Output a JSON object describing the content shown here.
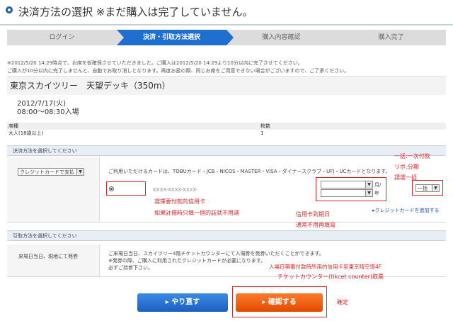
{
  "header": {
    "title": "決済方法の選択 ※まだ購入は完了していません。"
  },
  "steps": [
    {
      "label": "ログイン"
    },
    {
      "label": "決済・引取方法選択"
    },
    {
      "label": "購入内容確認"
    },
    {
      "label": "購入完了"
    }
  ],
  "notice": {
    "line1": "※2012/5/20 14:29時点で、お席を仮確保させていただきました。ご購入は2012/5/20 14:29より10分以内に完了させてください。",
    "line2": "ご購入が10分以内に完了しませんと、自動でお取り消しとなります。再度お扱の際、同じお席をご用意できない場合がございますので、ご了承ください。"
  },
  "event": {
    "name": "東京スカイツリー　天望デッキ（350m）",
    "date": "2012/7/17(火)",
    "time": "08:00〜08:30入場"
  },
  "seat_table": {
    "headers": [
      "席種",
      "枚数"
    ],
    "rows": [
      [
        "大人(18歳以上)",
        "1"
      ]
    ]
  },
  "payment": {
    "section_title": "決済方法を選択してください",
    "method_selected": "クレジットカードで支払",
    "cards_text": "ご利用いただけるカードは、TOBUカード・JCB・NICOS・MASTER・VISA・ダイナースクラブ・UFJ・UCカードとなります。",
    "card_number": "XXXX-XXXX-XXXX-",
    "month_label": "月/",
    "year_label": "年",
    "installment_value": "一括",
    "add_card_link": "▸クレジットカードを追加する"
  },
  "receive": {
    "section_title": "引取方法を選択してください",
    "method": "来場日当日、現地にて発券",
    "desc1": "ご来場日当日、スカイツリー4階チケットカウンターにて入場券を発券いただくことができます。",
    "desc2": "※発券の際、ご購入に利用されたクレジットカードが必要になります。",
    "desc3": "必ずご持参下さい。"
  },
  "buttons": {
    "redo": "▸ やり直す",
    "confirm": "▸ 確認する"
  },
  "annotations": {
    "lump_sum": "一括:一次付款",
    "revolving": "リボ:分期",
    "please_select": "請選一括",
    "pay_card": "選擇要付款的信用卡",
    "one_card_note": "如果註冊時只填一個的話就不用選",
    "expiry": "信用卡到期日",
    "expiry_note": "通常不用再填寫",
    "pickup": "入場日帶著付款時所用的信用卡至東京晴空塔4F",
    "counter": "チケットカウンター(tikcet counter)取票",
    "confirm_note": "確定"
  },
  "colors": {
    "accent": "#1f6fd0",
    "annotation": "#d9262a",
    "confirm": "#ff6a1a"
  }
}
